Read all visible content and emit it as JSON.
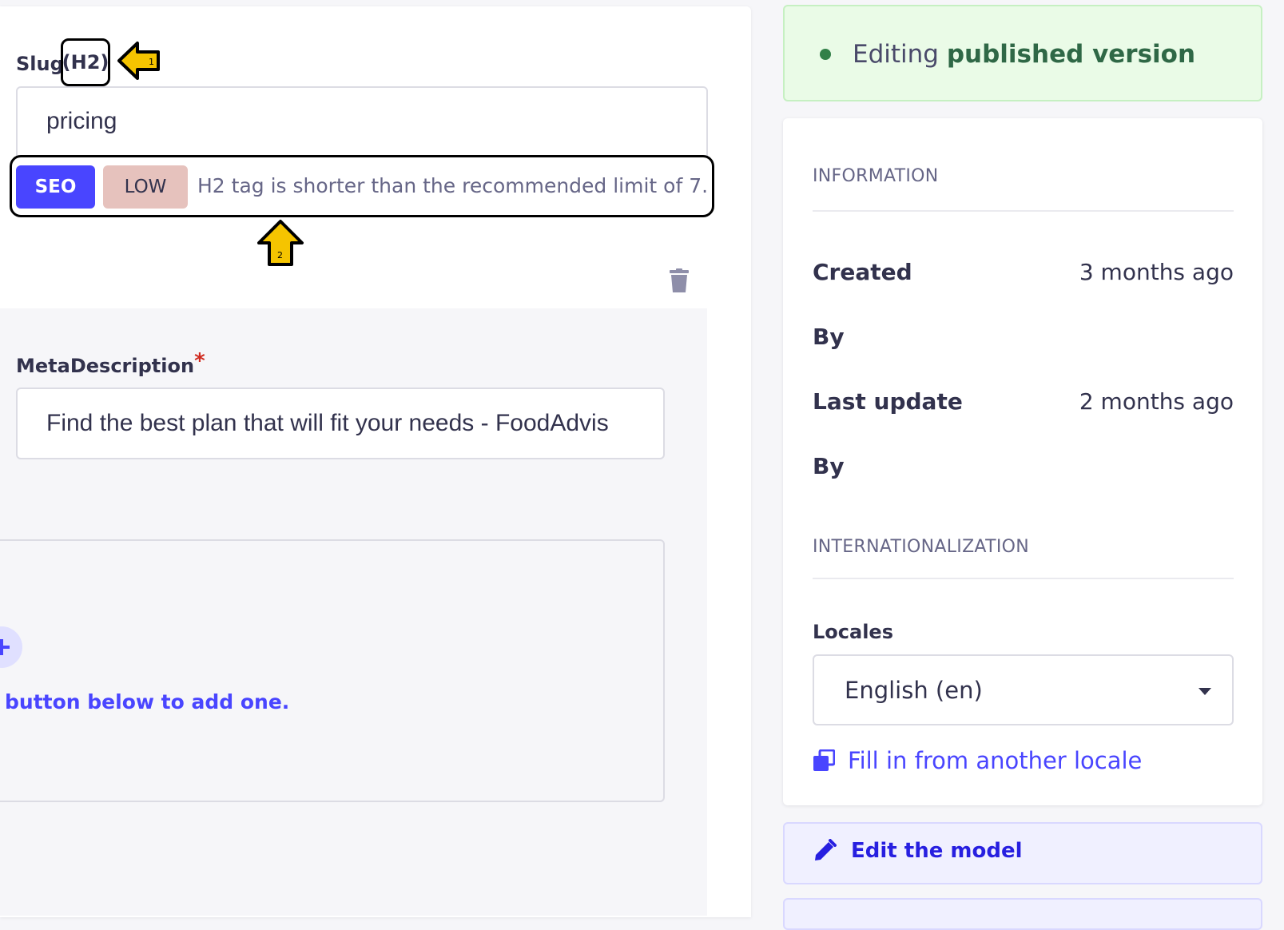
{
  "slug_field": {
    "label": "Slug",
    "heading_tag": "(H2)",
    "annotation_1": "1",
    "value": "pricing"
  },
  "seo_check": {
    "category_badge": "SEO",
    "severity_badge": "LOW",
    "message": "H2 tag is shorter than the recommended limit of 7.",
    "annotation_2": "2"
  },
  "meta_description": {
    "label": "MetaDescription",
    "required_marker": "*",
    "value": "Find the best plan that will fit your needs - FoodAdvis"
  },
  "dynamic_zone": {
    "hint": "button below to add one."
  },
  "status": {
    "prefix": "Editing",
    "state": "published version"
  },
  "information": {
    "title": "INFORMATION",
    "created_label": "Created",
    "created_value": "3 months ago",
    "created_by_label": "By",
    "updated_label": "Last update",
    "updated_value": "2 months ago",
    "updated_by_label": "By"
  },
  "internationalization": {
    "title": "INTERNATIONALIZATION",
    "locales_label": "Locales",
    "selected_locale": "English (en)",
    "fill_link": "Fill in from another locale"
  },
  "actions": {
    "edit_model": "Edit the model"
  },
  "colors": {
    "primary": "#4945ff",
    "success_bg": "#eafbe7",
    "danger": "#d02b20",
    "annotation": "#f5c400"
  }
}
